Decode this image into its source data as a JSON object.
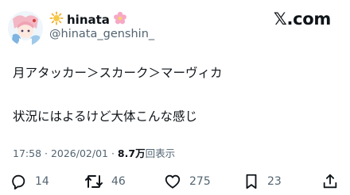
{
  "author": {
    "name": "hinata",
    "handle": "@hinata_genshin_",
    "leading_emoji": "sun-icon",
    "trailing_emoji": "cherry-blossom-icon"
  },
  "brand": {
    "logo_text": "𝕏.com"
  },
  "post": {
    "lines": [
      "月アタッカー＞スカーク＞マーヴィカ",
      "状況にはよるけど大体こんな感じ"
    ]
  },
  "meta": {
    "time": "17:58",
    "separator": " · ",
    "date": "2026/02/01",
    "views": "8.7万",
    "views_label": "回表示"
  },
  "actions": {
    "replies": "14",
    "reposts": "46",
    "likes": "275",
    "bookmarks": "23"
  },
  "colors": {
    "text": "#0f1419",
    "secondary": "#536471",
    "background": "#ffffff"
  }
}
